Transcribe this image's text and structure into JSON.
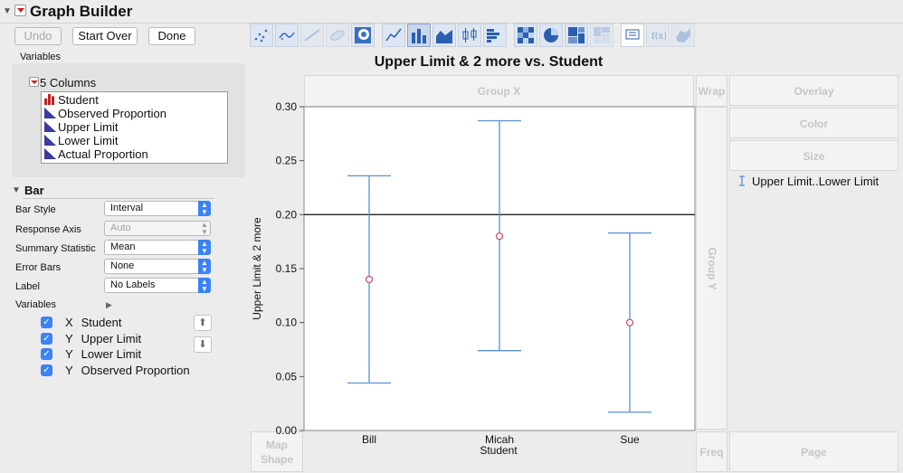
{
  "app": {
    "title": "Graph Builder"
  },
  "buttons": {
    "undo": "Undo",
    "start_over": "Start Over",
    "done": "Done"
  },
  "variables_panel": {
    "label": "Variables",
    "columns_header": "5 Columns",
    "columns": [
      {
        "name": "Student",
        "icon": "nominal-bar-icon"
      },
      {
        "name": "Observed Proportion",
        "icon": "continuous-icon"
      },
      {
        "name": "Upper Limit",
        "icon": "continuous-icon"
      },
      {
        "name": "Lower Limit",
        "icon": "continuous-icon"
      },
      {
        "name": "Actual Proportion",
        "icon": "continuous-icon"
      }
    ]
  },
  "bar_section": {
    "title": "Bar",
    "properties": [
      {
        "label": "Bar Style",
        "value": "Interval",
        "enabled": true
      },
      {
        "label": "Response Axis",
        "value": "Auto",
        "enabled": false
      },
      {
        "label": "Summary Statistic",
        "value": "Mean",
        "enabled": true
      },
      {
        "label": "Error Bars",
        "value": "None",
        "enabled": true
      },
      {
        "label": "Label",
        "value": "No Labels",
        "enabled": true
      }
    ],
    "variables_label": "Variables",
    "variable_roles": [
      {
        "role": "X",
        "name": "Student",
        "checked": true
      },
      {
        "role": "Y",
        "name": "Upper Limit",
        "checked": true
      },
      {
        "role": "Y",
        "name": "Lower Limit",
        "checked": true
      },
      {
        "role": "Y",
        "name": "Observed Proportion",
        "checked": true
      }
    ],
    "move_up_icon": "arrow-up-icon",
    "move_down_icon": "arrow-down-icon"
  },
  "zones": {
    "group_x": "Group X",
    "wrap": "Wrap",
    "group_y": "Group Y",
    "overlay": "Overlay",
    "color": "Color",
    "size": "Size",
    "map_shape": "Map Shape",
    "freq": "Freq",
    "page": "Page"
  },
  "legend": {
    "label": "Upper Limit..Lower Limit",
    "icon": "interval-icon"
  },
  "colors": {
    "interval": "#5b8fd6",
    "marker": "#d0466a",
    "reference_line": "#222222"
  },
  "chart_data": {
    "type": "interval",
    "title": "Upper Limit & 2 more vs. Student",
    "xlabel": "Student",
    "ylabel": "Upper Limit & 2 more",
    "categories": [
      "Bill",
      "Micah",
      "Sue"
    ],
    "series": [
      {
        "name": "Upper Limit",
        "values": [
          0.236,
          0.287,
          0.183
        ]
      },
      {
        "name": "Lower Limit",
        "values": [
          0.044,
          0.074,
          0.017
        ]
      },
      {
        "name": "Observed Proportion",
        "values": [
          0.14,
          0.18,
          0.1
        ]
      }
    ],
    "ylim": [
      0,
      0.3
    ],
    "yticks": [
      "0.00",
      "0.05",
      "0.10",
      "0.15",
      "0.20",
      "0.25",
      "0.30"
    ],
    "reference_line": 0.2,
    "grid": false,
    "legend_position": "right"
  }
}
